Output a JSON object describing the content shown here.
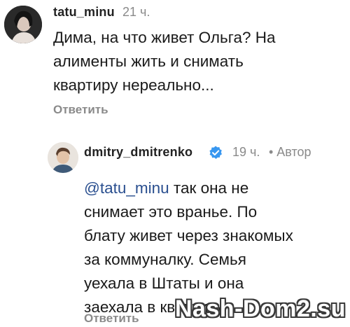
{
  "comment1": {
    "username": "tatu_minu",
    "time": "21 ч.",
    "text": "Дима, на что живет Ольга? На\nалименты жить и снимать\nквартиру нереально...",
    "reply_label": "Ответить"
  },
  "comment2": {
    "username": "dmitry_dmitrenko",
    "time": "19 ч.",
    "author_badge": "• Автор",
    "mention": "@tatu_minu",
    "text_after_mention": " так она не\nснимает это вранье. По\nблату живет через знакомых\nза коммуналку. Семья\nуехала в Штаты и она\nзаехала в квартиру",
    "reply_label": "Ответить"
  },
  "watermark": "Nash-Dom2.su",
  "colors": {
    "mention": "#2a4f8f",
    "verified": "#3897f0",
    "muted": "#8a8a8a"
  }
}
